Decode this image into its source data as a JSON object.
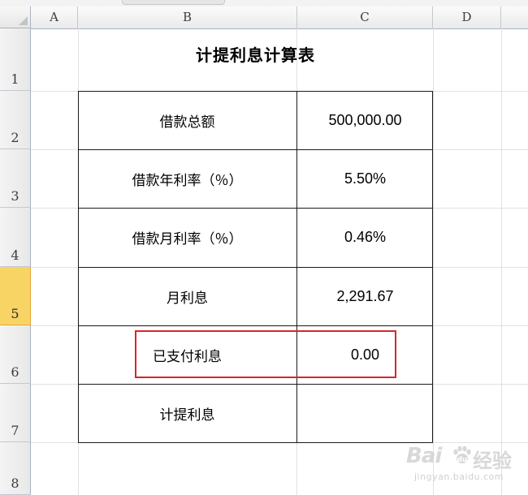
{
  "columns": [
    "A",
    "B",
    "C",
    "D"
  ],
  "rows": [
    "1",
    "2",
    "3",
    "4",
    "5",
    "6",
    "7",
    "8"
  ],
  "selected_row": "5",
  "title": "计提利息计算表",
  "table": [
    {
      "label": "借款总额",
      "value": "500,000.00"
    },
    {
      "label": "借款年利率（％）",
      "value": "5.50%"
    },
    {
      "label": "借款月利率（％）",
      "value": "0.46%"
    },
    {
      "label": "月利息",
      "value": "2,291.67"
    },
    {
      "label": "已支付利息",
      "value": "0.00"
    },
    {
      "label": "计提利息",
      "value": ""
    }
  ],
  "highlight_color": "#d6262c",
  "selected_row_color": "#f8d464",
  "watermark": {
    "logo": "Bai",
    "icon": "paw-icon",
    "suffix": "经验",
    "url": "jingyan.baidu.com"
  }
}
